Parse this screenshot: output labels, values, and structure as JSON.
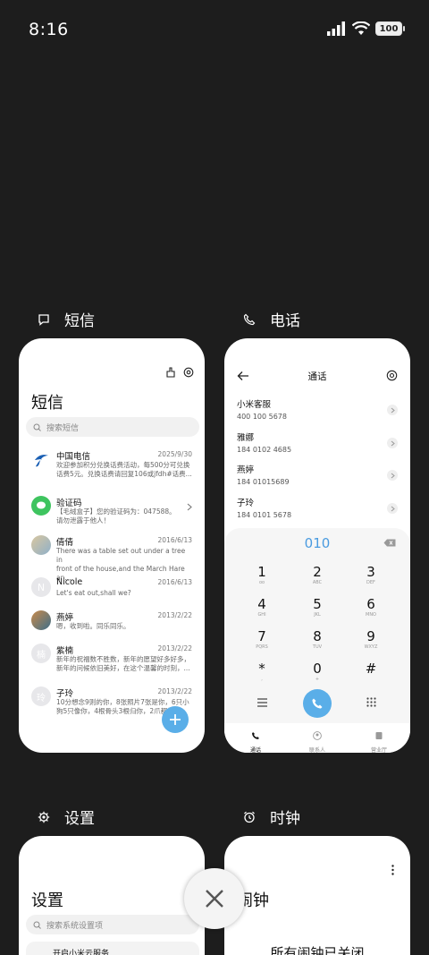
{
  "status_bar": {
    "time": "8:16",
    "battery": "100"
  },
  "apps": {
    "sms": {
      "label": "短信"
    },
    "phone": {
      "label": "电话"
    },
    "settings": {
      "label": "设置"
    },
    "clock": {
      "label": "时钟"
    }
  },
  "sms": {
    "title": "短信",
    "search_placeholder": "搜索短信",
    "messages": [
      {
        "name": "中国电信",
        "date": "2025/9/30",
        "preview": "欢迎参加积分兑换话费活动，每500分可兑换\n话费5元。兑换话费请回复106或jfdh#话费..."
      },
      {
        "name": "验证码",
        "date": "",
        "preview": "【毛绒盒子】您的验证码为：047588。\n请勿泄露于他人！"
      },
      {
        "name": "倩倩",
        "date": "2016/6/13",
        "preview": "There was a table set out under a tree in\nfront of the house,and the March Hare an..."
      },
      {
        "name": "Nicole",
        "date": "2016/6/13",
        "preview": "Let's eat out,shall we?"
      },
      {
        "name": "燕婷",
        "date": "2013/2/22",
        "preview": "嗯，收到啦。同乐同乐。"
      },
      {
        "name": "紫楠",
        "date": "2013/2/22",
        "preview": "新年的祝福数不胜数，新年的愿望好多好多，\n新年的问候依旧美好，在这个温馨的时刻，..."
      },
      {
        "name": "子玲",
        "date": "2013/2/22",
        "preview": "10分想念9则的你，8张照片7张是你，6只小\n狗5只像你，4根骨头3根归你，2爪都给你..."
      }
    ]
  },
  "phone": {
    "title": "通话",
    "contacts": [
      {
        "name": "小米客服",
        "number": "400 100 5678"
      },
      {
        "name": "雅娜",
        "number": "184 0102 4685"
      },
      {
        "name": "燕婷",
        "number": "184 01015689"
      },
      {
        "name": "子玲",
        "number": "184 0101 5678"
      }
    ],
    "dial_input": "010",
    "keys": [
      {
        "d": "1",
        "l": "oo"
      },
      {
        "d": "2",
        "l": "ABC"
      },
      {
        "d": "3",
        "l": "DEF"
      },
      {
        "d": "4",
        "l": "GHI"
      },
      {
        "d": "5",
        "l": "JKL"
      },
      {
        "d": "6",
        "l": "MNO"
      },
      {
        "d": "7",
        "l": "PQRS"
      },
      {
        "d": "8",
        "l": "TUV"
      },
      {
        "d": "9",
        "l": "WXYZ"
      },
      {
        "d": "*",
        "l": ","
      },
      {
        "d": "0",
        "l": "+"
      },
      {
        "d": "#",
        "l": ""
      }
    ],
    "nav": [
      "通话",
      "联系人",
      "营业厅"
    ]
  },
  "settings": {
    "title": "设置",
    "search_placeholder": "搜索系统设置项",
    "first_row": "开启小米云服务"
  },
  "clock": {
    "title": "闹钟",
    "message": "所有闹钟已关闭"
  },
  "colors": {
    "accent": "#5aaee8",
    "background": "#1d1d1d"
  }
}
